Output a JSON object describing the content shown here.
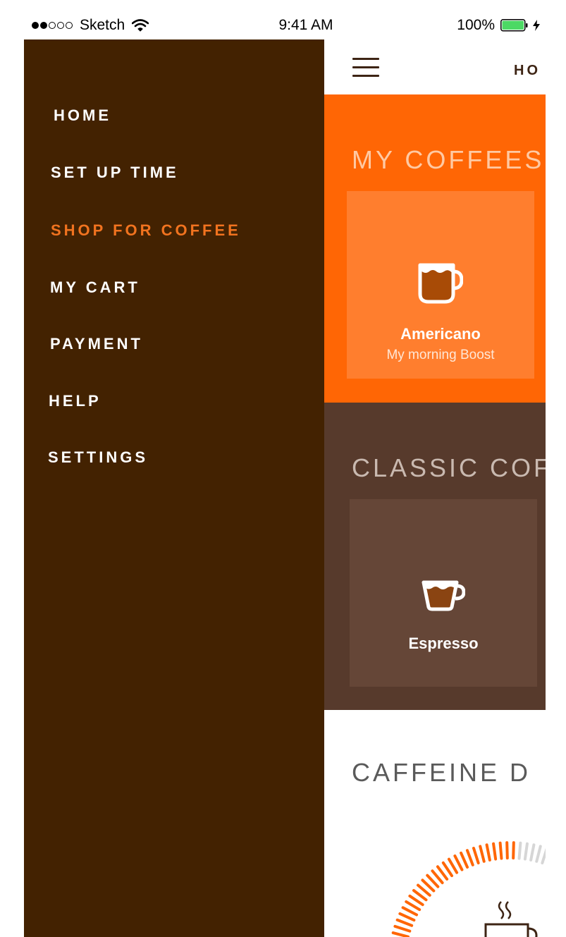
{
  "status_bar": {
    "carrier": "Sketch",
    "time": "9:41 AM",
    "battery": "100%",
    "signal_bars_full": 2,
    "signal_bars_total": 5,
    "battery_level": 1.0,
    "battery_color": "#4cd964",
    "icons": [
      "signal-dots",
      "wifi-icon",
      "battery-icon",
      "bolt-icon"
    ]
  },
  "drawer": {
    "background": "#432201",
    "active_color": "#f1731f",
    "items": [
      {
        "label": "HOME"
      },
      {
        "label": "SET UP TIME"
      },
      {
        "label": "SHOP FOR COFFEE",
        "active": true
      },
      {
        "label": "MY CART"
      },
      {
        "label": "PAYMENT"
      },
      {
        "label": "HELP"
      },
      {
        "label": "SETTINGS"
      }
    ]
  },
  "header": {
    "title": "HO",
    "menu_icon": "hamburger-menu-icon"
  },
  "my_coffees": {
    "title": "MY COFFEES",
    "background": "#ff6605",
    "cards": [
      {
        "name": "Americano",
        "subtitle": "My morning Boost",
        "icon": "mug-icon"
      }
    ]
  },
  "classic_coffees": {
    "title": "CLASSIC COF",
    "background": "#573a2c",
    "cards": [
      {
        "name": "Espresso",
        "icon": "espresso-cup-icon"
      }
    ]
  },
  "caffeine": {
    "title": "CAFFEINE D",
    "accent": "#ff6605",
    "icon": "steaming-cup-icon"
  }
}
